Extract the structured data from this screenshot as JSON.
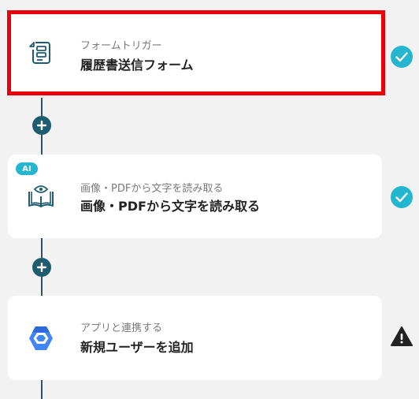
{
  "steps": [
    {
      "subtitle": "フォームトリガー",
      "title": "履歴書送信フォーム",
      "icon": "form-icon",
      "status": "check-icon"
    },
    {
      "badge": "AI",
      "subtitle": "画像・PDFから文字を読み取る",
      "title": "画像・PDFから文字を読み取る",
      "icon": "ocr-book-eye-icon",
      "status": "check-icon"
    },
    {
      "subtitle": "アプリと連携する",
      "title": "新規ユーザーを追加",
      "icon": "google-workspace-hexagon-icon",
      "status": "warning-icon"
    }
  ],
  "colors": {
    "accent": "#24b6cf",
    "connector": "#2e5566",
    "add_button": "#1f5c70",
    "highlight": "#e8000b",
    "warning": "#222222"
  }
}
